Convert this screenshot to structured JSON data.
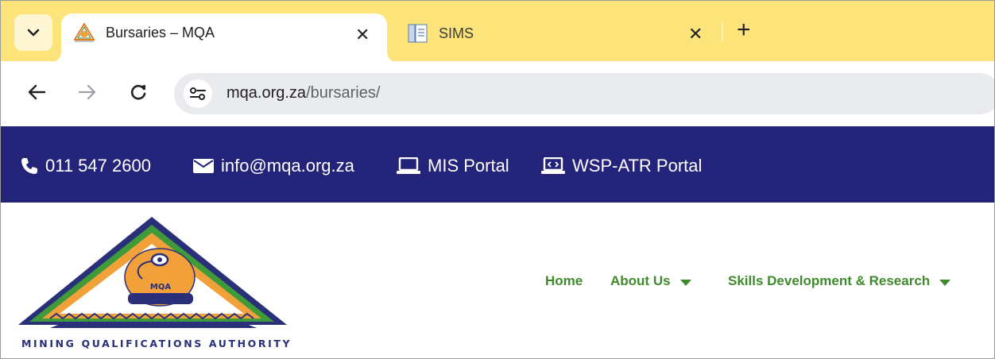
{
  "browser": {
    "tabs": [
      {
        "title": "Bursaries – MQA",
        "active": true,
        "icon": "mqa-favicon"
      },
      {
        "title": "SIMS",
        "active": false,
        "icon": "document-favicon"
      }
    ],
    "new_tab_icon": "plus-icon",
    "url_domain": "mqa.org.za",
    "url_path": "/bursaries/",
    "tabstrip_color": "#fde47a"
  },
  "topbar": {
    "phone": "011 547 2600",
    "email": "info@mqa.org.za",
    "mis_portal": "MIS Portal",
    "wsp_portal": "WSP-ATR Portal",
    "background": "#23237a"
  },
  "site": {
    "logo_badge": "MQA",
    "logo_tagline": "MINING QUALIFICATIONS AUTHORITY",
    "menu": [
      {
        "label": "Home",
        "has_dropdown": false
      },
      {
        "label": "About Us",
        "has_dropdown": true
      },
      {
        "label": "Skills Development & Research",
        "has_dropdown": true
      }
    ],
    "menu_color": "#3f8a2c"
  }
}
